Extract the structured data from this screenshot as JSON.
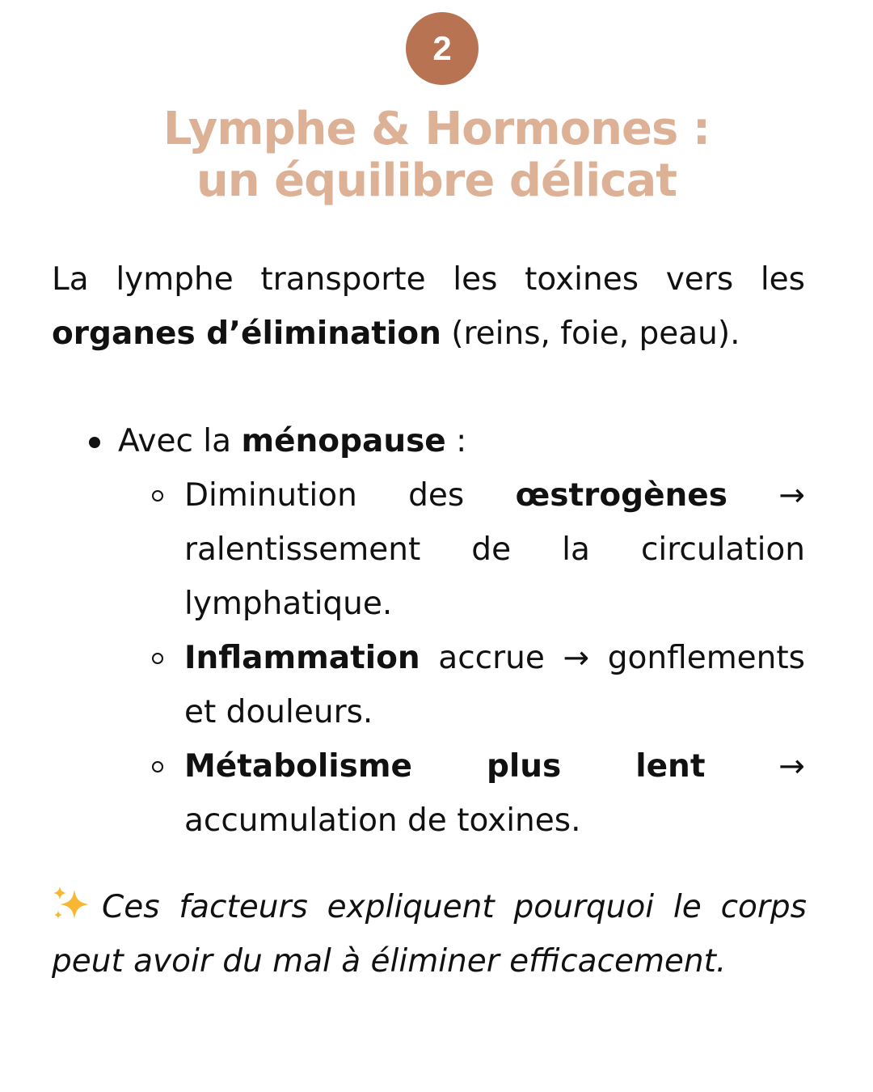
{
  "badge": {
    "number": "2"
  },
  "title": {
    "line1": "Lymphe & Hormones :",
    "line2": "un équilibre délicat"
  },
  "intro": {
    "text_before": "La lymphe transporte les toxines vers les ",
    "bold": "organes d’élimination",
    "text_after": " (reins, foie, peau)."
  },
  "bullet": {
    "prefix": "Avec la ",
    "bold": "ménopause",
    "suffix": " :",
    "subitems": [
      {
        "pre": "Diminution des ",
        "bold": "œstrogènes",
        "arrow": "→",
        "rest": "ralentissement de la circulation lymphatique."
      },
      {
        "pre": "",
        "bold": "Inflammation",
        "mid": " accrue ",
        "arrow": "→",
        "rest": "gonflements et douleurs."
      },
      {
        "pre": "",
        "bold": "Métabolisme plus lent",
        "arrow": "→",
        "rest": "accumulation de toxines."
      }
    ]
  },
  "closing": {
    "icon": "sparkles-icon",
    "text": "Ces facteurs expliquent pourquoi le corps peut avoir du mal à éliminer efficacement."
  },
  "colors": {
    "badge": "#b87452",
    "title": "#ddb195",
    "text": "#111111",
    "sparkle": "#f7b733"
  }
}
